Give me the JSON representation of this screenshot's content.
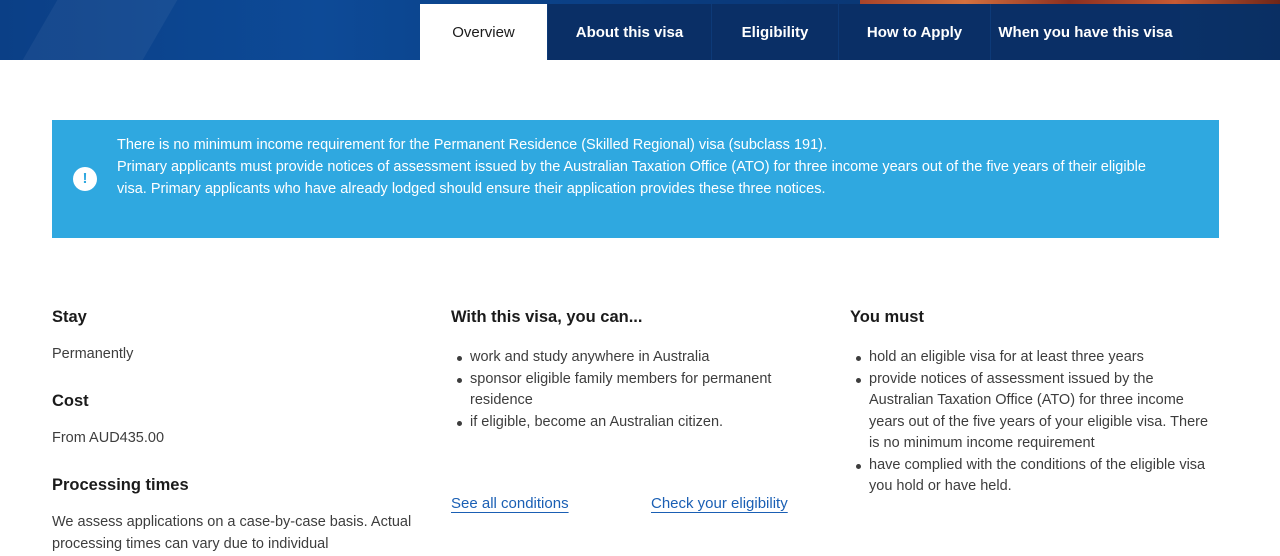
{
  "tabs": [
    {
      "label": "Overview",
      "active": true
    },
    {
      "label": "About this visa",
      "active": false
    },
    {
      "label": "Eligibility",
      "active": false
    },
    {
      "label": "How to Apply",
      "active": false
    },
    {
      "label": "When you have this visa",
      "active": false
    }
  ],
  "alert": {
    "icon": "exclamation-icon",
    "line1": "There is no minimum income requirement for the Permanent Residence (Skilled Regional) visa (subclass 191).",
    "line2": "Primary applicants must provide notices of assessment issued by the Australian Taxation Office (ATO) for three income years out of the five years of their eligible visa. Primary applicants who have already lodged should ensure their application provides these three notices.",
    "color": "#2fa8e0"
  },
  "summary": {
    "stay": {
      "heading": "Stay",
      "value": "Permanently"
    },
    "cost": {
      "heading": "Cost",
      "value": "From AUD435.00"
    },
    "processing": {
      "heading": "Processing times",
      "value": "We assess applications on a case-by-case basis. Actual processing times can vary due to individual"
    }
  },
  "can": {
    "heading": "With this visa, you can...",
    "items": [
      "work and study anywhere in Australia",
      "sponsor eligible family members for permanent residence",
      "if eligible, become an Australian citizen."
    ]
  },
  "must": {
    "heading": "You must",
    "items": [
      "hold an eligible visa for at least three years",
      "provide notices of assessment issued by the Australian Taxation Office (ATO) for three income years out of the five years of your eligible visa. There is no minimum income requirement",
      " have complied with the conditions of the eligible visa you hold or have held."
    ]
  },
  "links": {
    "conditions": "See all conditions",
    "eligibility": "Check your eligibility"
  },
  "colors": {
    "header": "#0a2f66",
    "link": "#1a5fb4"
  }
}
